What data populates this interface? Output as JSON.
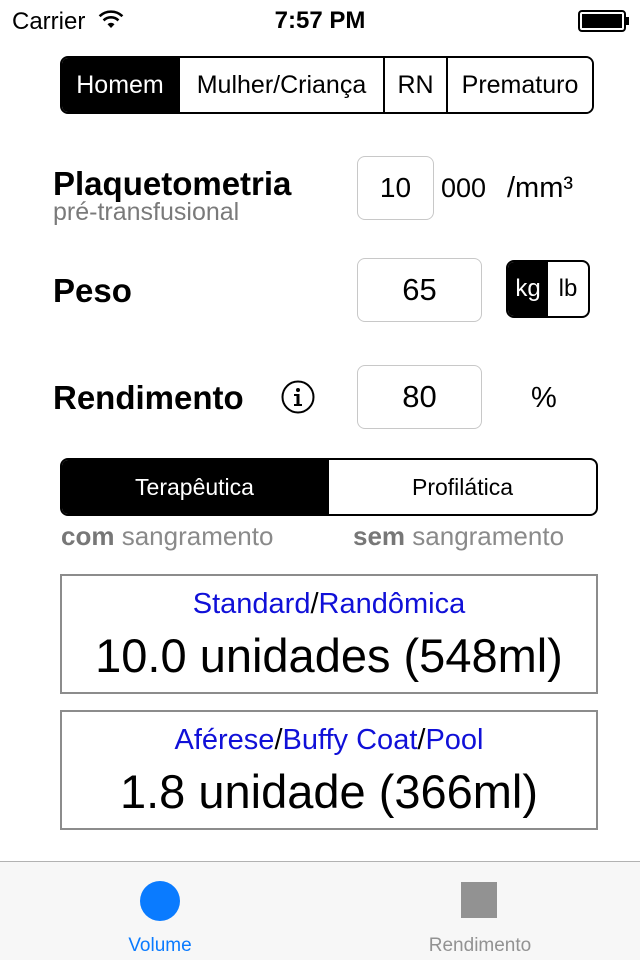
{
  "status_bar": {
    "carrier": "Carrier",
    "time": "7:57 PM",
    "wifi_icon": "wifi-icon",
    "battery_icon": "battery-icon"
  },
  "patient_type": {
    "options": [
      "Homem",
      "Mulher/Criança",
      "RN",
      "Prematuro"
    ],
    "selected": "Homem"
  },
  "platelet": {
    "label": "Plaquetometria",
    "sublabel": "pré-transfusional",
    "value": "10",
    "multiplier": "000",
    "unit": "/mm³"
  },
  "weight": {
    "label": "Peso",
    "value": "65",
    "unit_options": [
      "kg",
      "lb"
    ],
    "selected_unit": "kg"
  },
  "yield": {
    "label": "Rendimento",
    "info_icon": "info-icon",
    "value": "80",
    "unit": "%"
  },
  "mode": {
    "options": [
      "Terapêutica",
      "Profilática"
    ],
    "selected": "Terapêutica",
    "captions": [
      {
        "bold": "com",
        "rest": " sangramento"
      },
      {
        "bold": "sem",
        "rest": " sangramento"
      }
    ]
  },
  "results": [
    {
      "type_parts": [
        "Standard",
        "/",
        "Randômica"
      ],
      "amount": "10.0 unidades (548ml)"
    },
    {
      "type_parts": [
        "Aférese",
        "/",
        "Buffy Coat",
        "/",
        "Pool"
      ],
      "amount": "1.8 unidade (366ml)"
    }
  ],
  "tab_bar": {
    "tabs": [
      {
        "label": "Volume",
        "icon": "circle-icon",
        "active": true
      },
      {
        "label": "Rendimento",
        "icon": "square-icon",
        "active": false
      }
    ]
  },
  "colors": {
    "accent": "#0a7bff",
    "link_blue": "#1010d8",
    "inactive_tab": "#929292"
  }
}
